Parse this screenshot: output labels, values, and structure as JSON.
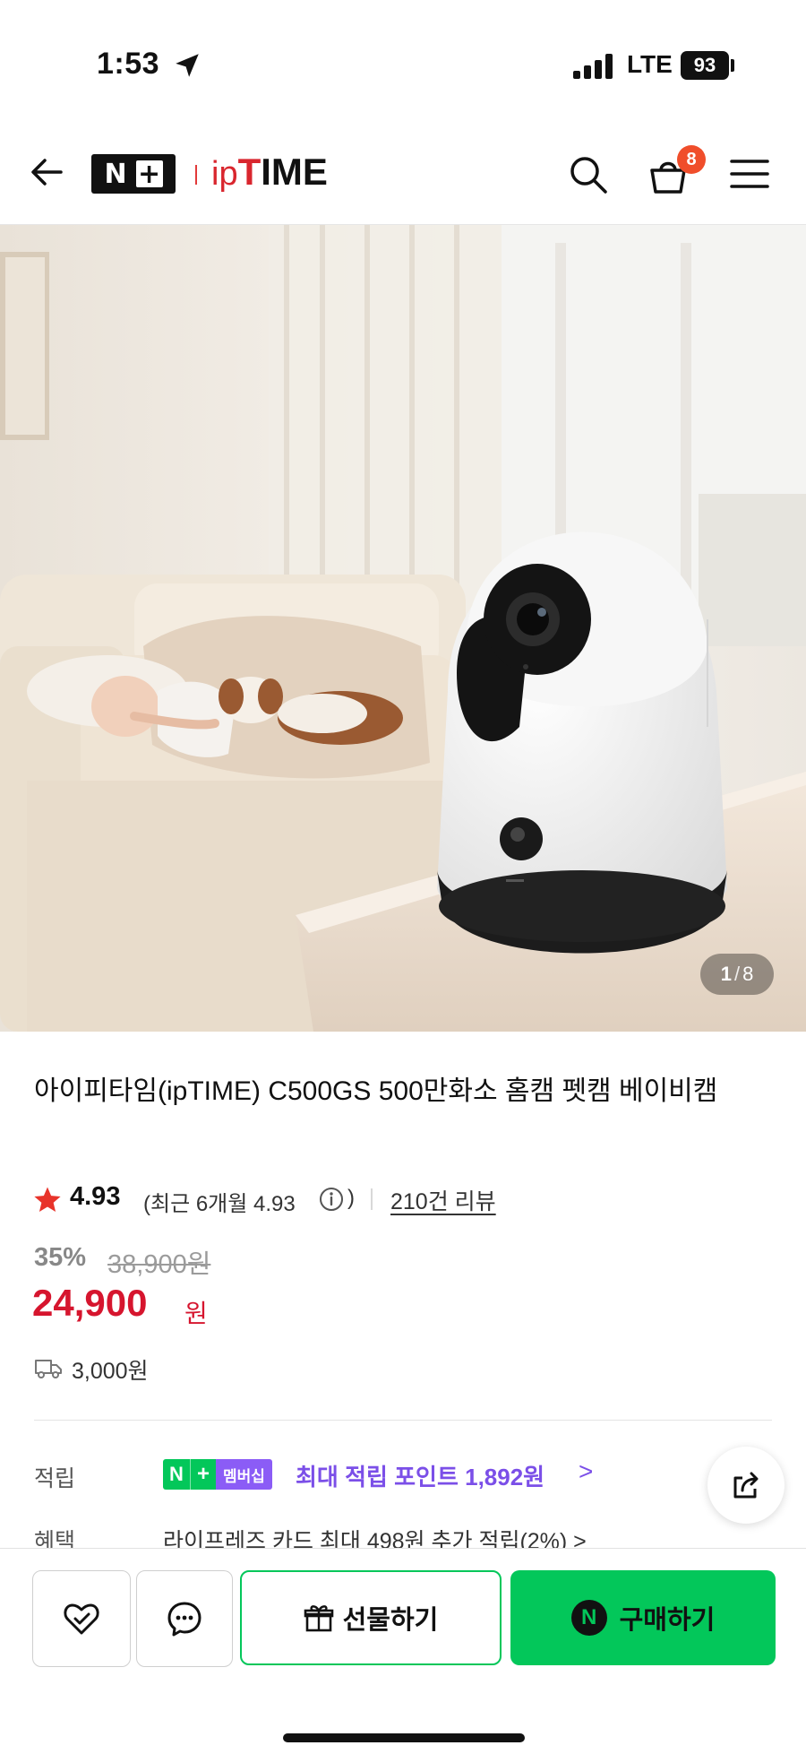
{
  "status_bar": {
    "time": "1:53",
    "network": "LTE",
    "battery": "93"
  },
  "header": {
    "logo_n": "N",
    "logo_plus": "+",
    "brand_ip": "ip",
    "brand_t": "T",
    "brand_ime": "IME",
    "cart_count": "8",
    "icons": [
      "back-icon",
      "search-icon",
      "cart-icon",
      "menu-icon"
    ]
  },
  "gallery": {
    "current": "1",
    "separator": "/",
    "total": "8"
  },
  "product": {
    "title": "아이피타임(ipTIME) C500GS 500만화소 홈캠 펫캠 베이비캠",
    "rating": "4.93",
    "recent_label": "(최근 6개월 4.93",
    "recent_close": ")",
    "review_count": "210건 리뷰",
    "discount": "35%",
    "original_price": "38,900원",
    "price": "24,900",
    "price_unit": "원",
    "shipping_fee": "3,000원"
  },
  "benefits": {
    "points_label": "적립",
    "badge_n": "N",
    "badge_plus": "+",
    "badge_membership": "멤버십",
    "points_text": "최대 적립 포인트 1,892원",
    "points_chevron": ">",
    "benefit_label": "혜택",
    "benefit_text": "라이프레즈 카드 최대 498원 추가 적립(2%) >"
  },
  "bottom_bar": {
    "gift_label": "선물하기",
    "buy_label": "구매하기",
    "buy_logo": "N"
  },
  "colors": {
    "price_red": "#d6152e",
    "naver_green": "#03c75a",
    "membership_purple": "#7b4fe8",
    "cart_badge": "#f04e2b"
  }
}
